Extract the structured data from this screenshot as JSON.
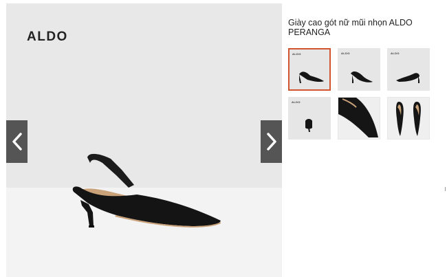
{
  "brand": {
    "logo_text": "ALDO"
  },
  "product": {
    "title": "Giày cao gót nữ mũi nhọn ALDO PERANGA"
  },
  "navigation": {
    "prev_icon": "chevron-left-icon",
    "next_icon": "chevron-right-icon"
  },
  "thumbnails": [
    {
      "logo": "ALDO",
      "view": "side-view-selected"
    },
    {
      "logo": "ALDO",
      "view": "front-angle-view"
    },
    {
      "logo": "ALDO",
      "view": "back-side-view"
    },
    {
      "logo": "ALDO",
      "view": "rear-view"
    },
    {
      "logo": "",
      "view": "toe-closeup"
    },
    {
      "logo": "",
      "view": "top-down-pair"
    }
  ],
  "colors": {
    "accent": "#d2552f",
    "nav_bg": "#555555",
    "stage_bg": "#e8e8e8"
  }
}
